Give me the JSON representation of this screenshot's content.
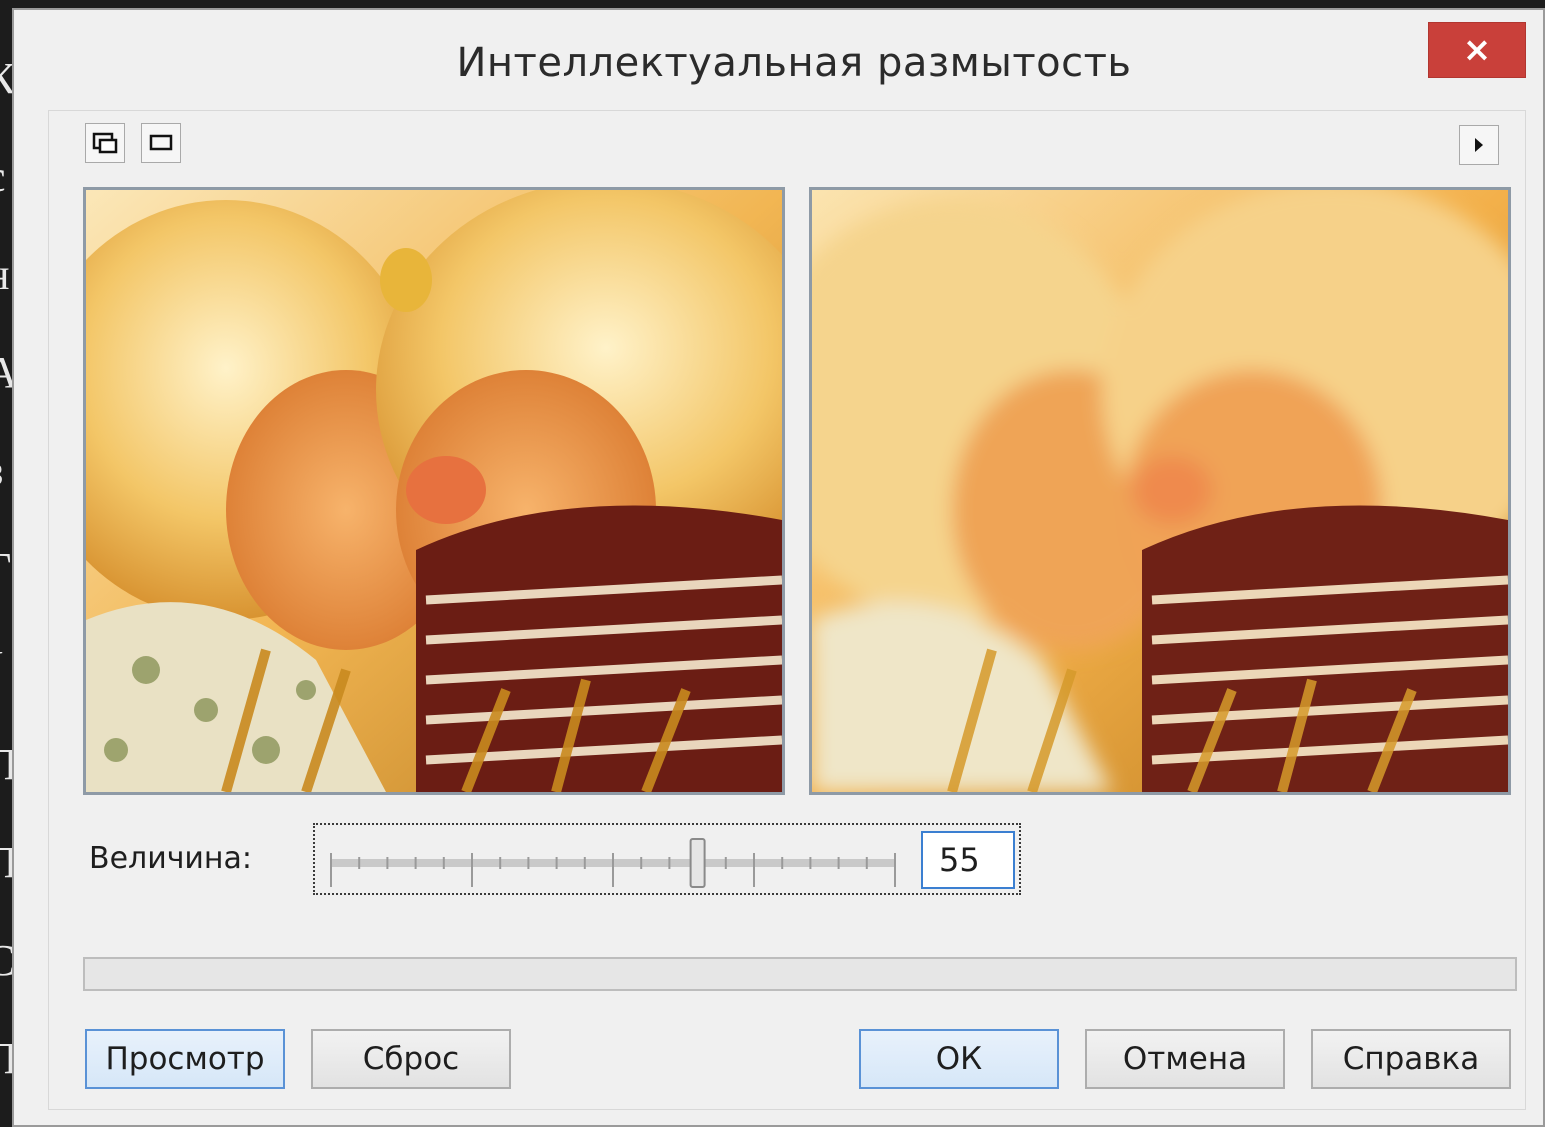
{
  "dialog": {
    "title": "Интеллектуальная размытость",
    "close_glyph": "×"
  },
  "toolbar": {
    "left_icons": [
      "zoom-region-icon",
      "frame-icon"
    ],
    "right_icon": "play-triangle-icon"
  },
  "slider": {
    "label": "Величина:",
    "value": "55",
    "fraction": 0.65
  },
  "progress": {
    "fraction": 0
  },
  "buttons": {
    "preview": "Просмотр",
    "reset": "Сброс",
    "ok": "ОК",
    "cancel": "Отмена",
    "help": "Справка"
  },
  "colors": {
    "close_button": "#c9403a",
    "focus_border": "#3b7fd1",
    "default_button_border": "#5a92d6"
  }
}
